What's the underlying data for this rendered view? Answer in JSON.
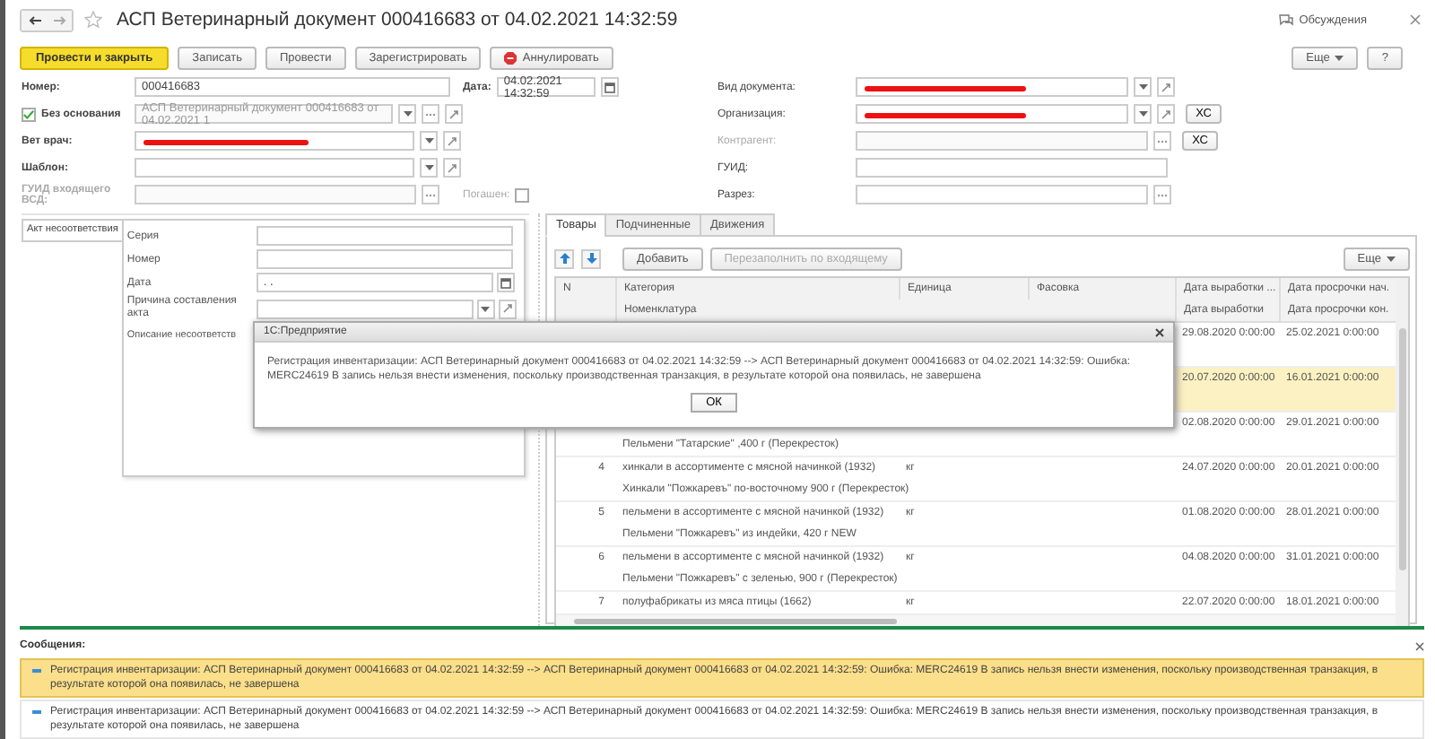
{
  "window": {
    "title": "АСП Ветеринарный документ 000416683 от 04.02.2021 14:32:59",
    "discussions": "Обсуждения"
  },
  "toolbar": {
    "buttons": [
      {
        "label": "Провести и закрыть",
        "kind": "primary"
      },
      {
        "label": "Записать",
        "kind": "plain"
      },
      {
        "label": "Провести",
        "kind": "plain"
      },
      {
        "label": "Зарегистрировать",
        "kind": "plain"
      },
      {
        "label": "Аннулировать",
        "kind": "cancel"
      }
    ],
    "more": "Еще",
    "help": "?"
  },
  "left_fields": [
    {
      "label": "Номер:",
      "value": "000416683",
      "kind": "text",
      "extra": {
        "label": "Дата:",
        "value": "04.02.2021 14:32:59",
        "kind": "date"
      }
    },
    {
      "label": "Без основания",
      "kind": "check",
      "checked": true,
      "value": "АСП Ветеринарный документ 000416683 от 04.02.2021 1",
      "disabled": true
    },
    {
      "label": "Вет врач:",
      "kind": "select",
      "redacted": true
    },
    {
      "label": "Шаблон:",
      "kind": "select"
    },
    {
      "label": "ГУИД входящего ВСД:",
      "kind": "choose",
      "disabled": true,
      "extra": {
        "label": "Погашен:",
        "kind": "flag",
        "checked": false
      }
    }
  ],
  "right_fields": [
    {
      "label": "Вид документа:",
      "kind": "select",
      "redacted": true
    },
    {
      "label": "Организация:",
      "kind": "select",
      "redacted": true,
      "button": "ХС"
    },
    {
      "label": "Контрагент:",
      "kind": "choose",
      "disabled": true,
      "button": "ХС"
    },
    {
      "label": "ГУИД:",
      "kind": "text"
    },
    {
      "label": "Разрез:",
      "kind": "choose"
    }
  ],
  "act": {
    "tab": "Акт несоответствия",
    "fields": [
      {
        "label": "Серия",
        "kind": "text"
      },
      {
        "label": "Номер",
        "kind": "text"
      },
      {
        "label": "Дата",
        "kind": "date",
        "placeholder": " .  ."
      },
      {
        "label": "Причина составления акта",
        "kind": "select"
      },
      {
        "label": "Описание несоответств",
        "kind": "none"
      }
    ]
  },
  "tabs": [
    {
      "label": "Товары",
      "selected": true
    },
    {
      "label": "Подчиненные",
      "selected": false
    },
    {
      "label": "Движения",
      "selected": false
    }
  ],
  "table_toolbar": {
    "add": "Добавить",
    "refill": "Перезаполнить по входящему",
    "more": "Еще"
  },
  "table": {
    "columns": [
      [
        "N"
      ],
      [
        "Категория",
        "Номенклатура"
      ],
      [
        "Единица"
      ],
      [
        "Фасовка"
      ],
      [
        "Дата выработки ...",
        "Дата выработки"
      ],
      [
        "Дата просрочки нач.",
        "Дата просрочки кон."
      ]
    ],
    "rows": [
      {
        "selected": false,
        "date_made": "29.08.2020 0:00:00",
        "date_expiry": "25.02.2021 0:00:00"
      },
      {
        "selected": true,
        "date_made": "20.07.2020 0:00:00",
        "date_expiry": "16.01.2021 0:00:00"
      },
      {
        "selected": false,
        "date_made": "02.08.2020 0:00:00",
        "date_expiry": "29.01.2021 0:00:00",
        "nomenclature": "Пельмени \"Татарские\" ,400 г (Перекресток)"
      },
      {
        "selected": false,
        "n": "4",
        "category": "хинкали в ассортименте с мясной начинкой (1932)",
        "unit": "кг",
        "date_made": "24.07.2020 0:00:00",
        "date_expiry": "20.01.2021 0:00:00",
        "nomenclature": "Хинкали \"Пожкаревъ\" по-восточному 900 г (Перекресток)"
      },
      {
        "selected": false,
        "n": "5",
        "category": "пельмени в ассортименте с мясной начинкой (1932)",
        "unit": "кг",
        "date_made": "01.08.2020 0:00:00",
        "date_expiry": "28.01.2021 0:00:00",
        "nomenclature": "Пельмени \"Пожкаревъ\" из индейки, 420 г NEW"
      },
      {
        "selected": false,
        "n": "6",
        "category": "пельмени в ассортименте с мясной начинкой (1932)",
        "unit": "кг",
        "date_made": "04.08.2020 0:00:00",
        "date_expiry": "31.01.2021 0:00:00",
        "nomenclature": "Пельмени \"Пожкаревъ\" с зеленью, 900 г (Перекресток)"
      },
      {
        "selected": false,
        "n": "7",
        "category": "полуфабрикаты из мяса птицы (1662)",
        "unit": "кг",
        "date_made": "22.07.2020 0:00:00",
        "date_expiry": "18.01.2021 0:00:00"
      }
    ]
  },
  "dialog": {
    "title": "1С:Предприятие",
    "text": "Регистрация инвентаризации: АСП Ветеринарный документ 000416683 от 04.02.2021 14:32:59 --> АСП Ветеринарный документ 000416683 от 04.02.2021 14:32:59: Ошибка: MERC24619 В запись нельзя внести изменения, поскольку производственная транзакция, в результате которой она появилась, не завершена",
    "button": "ОК"
  },
  "messages": {
    "title": "Сообщения:",
    "items": [
      {
        "selected": true,
        "text": "Регистрация инвентаризации: АСП Ветеринарный документ 000416683 от 04.02.2021 14:32:59 --> АСП Ветеринарный документ 000416683 от 04.02.2021 14:32:59: Ошибка: MERC24619 В запись нельзя внести изменения, поскольку производственная транзакция, в результате которой она появилась, не завершена"
      },
      {
        "selected": false,
        "text": "Регистрация инвентаризации: АСП Ветеринарный документ 000416683 от 04.02.2021 14:32:59 --> АСП Ветеринарный документ 000416683 от 04.02.2021 14:32:59: Ошибка: MERC24619 В запись нельзя внести изменения, поскольку производственная транзакция, в результате которой она появилась, не завершена"
      }
    ]
  }
}
